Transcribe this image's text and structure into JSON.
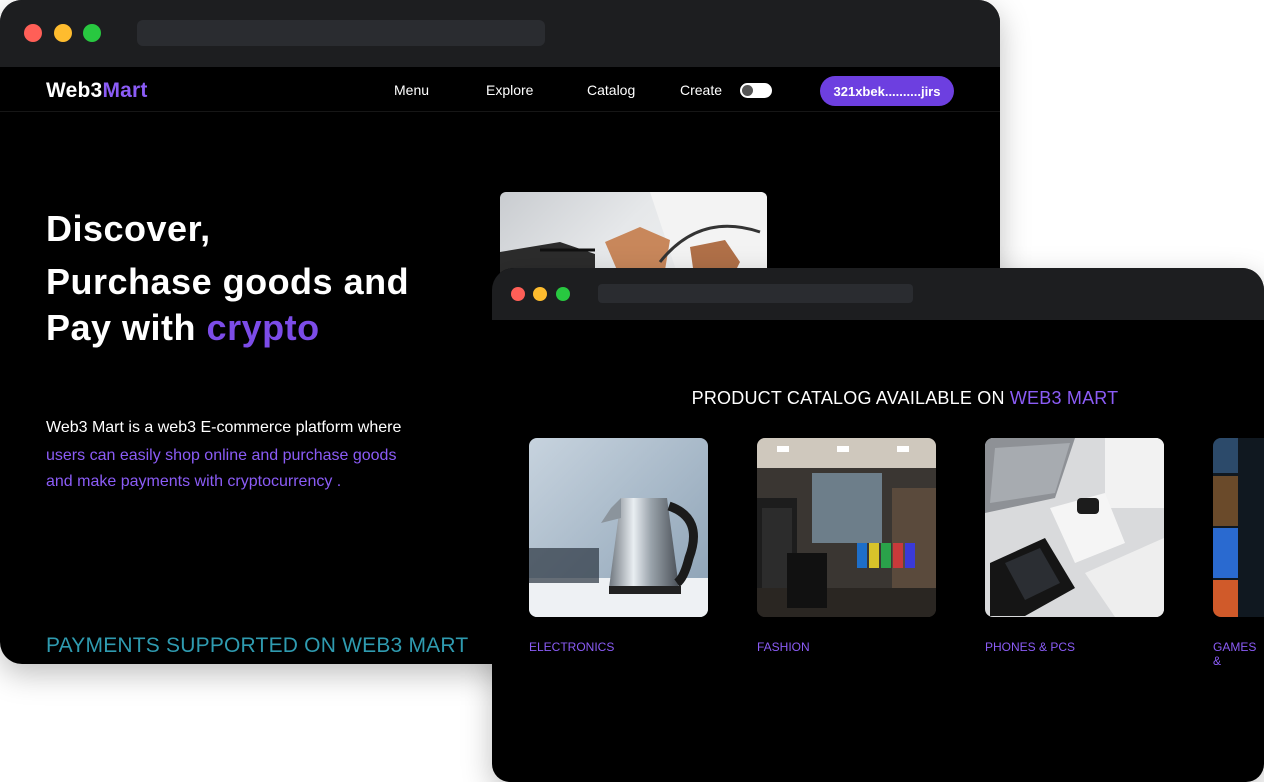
{
  "window1": {
    "logo": {
      "part1": "Web3",
      "part2": "Mart"
    },
    "nav": {
      "menu": "Menu",
      "explore": "Explore",
      "catalog": "Catalog",
      "create": "Create",
      "wallet": "321xbek..........jirs"
    },
    "hero": {
      "line1": "Discover,",
      "line2": "Purchase goods and",
      "line3_prefix": "Pay with ",
      "line3_accent": "crypto"
    },
    "description": {
      "line1": "Web3 Mart is a web3 E-commerce platform where",
      "line2": "users can easily shop online and purchase goods",
      "line3": "and make payments with cryptocurrency ."
    },
    "payments_heading": "PAYMENTS SUPPORTED ON WEB3 MART"
  },
  "window2": {
    "title_prefix": "PRODUCT CATALOG AVAILABLE ON ",
    "title_accent": "WEB3 MART",
    "categories": [
      {
        "label": "ELECTRONICS"
      },
      {
        "label": "FASHION"
      },
      {
        "label": "PHONES & PCS"
      },
      {
        "label": "GAMES &"
      }
    ]
  },
  "colors": {
    "accent": "#8b5cf6",
    "wallet_button": "#6d3fe0",
    "payments_heading": "#2f9bb0",
    "titlebar": "#1d1e20"
  }
}
